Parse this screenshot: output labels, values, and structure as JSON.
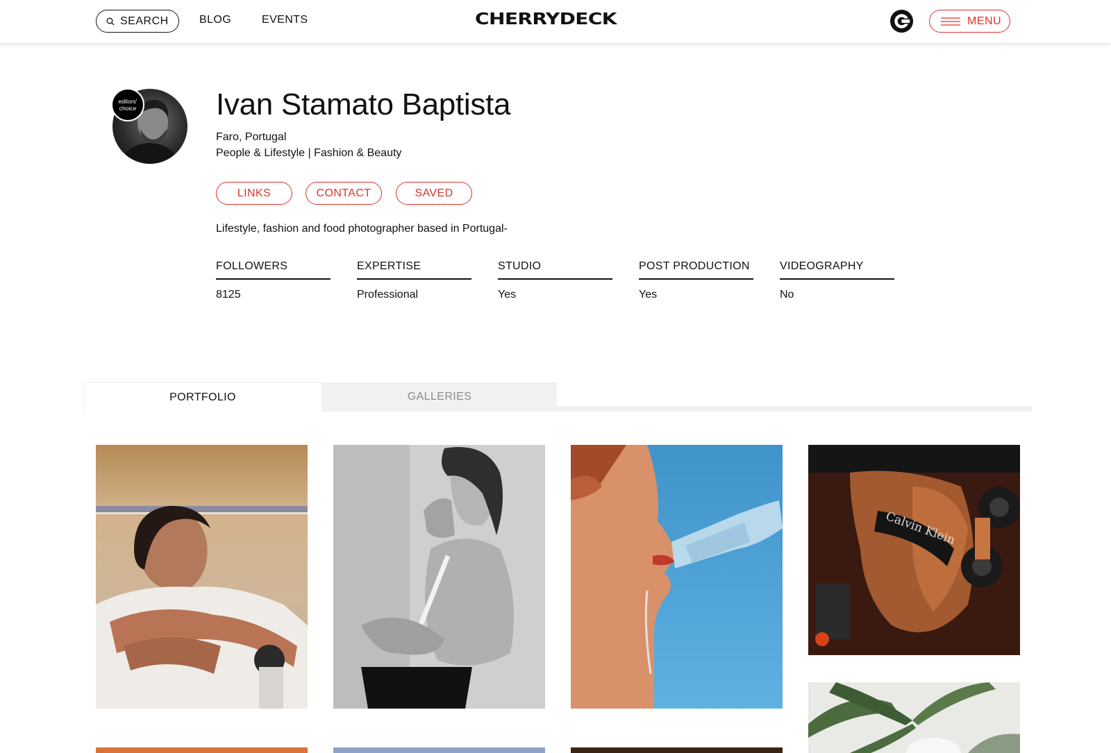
{
  "header": {
    "search_label": "SEARCH",
    "nav": [
      {
        "label": "BLOG"
      },
      {
        "label": "EVENTS"
      }
    ],
    "logo_text": "CHERRYDECK",
    "menu_label": "MENU"
  },
  "profile": {
    "badge_text": "editors' choice",
    "name": "Ivan Stamato Baptista",
    "location": "Faro, Portugal",
    "categories": "People & Lifestyle | Fashion & Beauty",
    "actions": [
      {
        "label": "LINKS"
      },
      {
        "label": "CONTACT"
      },
      {
        "label": "SAVED"
      }
    ],
    "bio": "Lifestyle, fashion and food photographer based in Portugal-",
    "stats": [
      {
        "label": "FOLLOWERS",
        "value": "8125"
      },
      {
        "label": "EXPERTISE",
        "value": "Professional"
      },
      {
        "label": "STUDIO",
        "value": "Yes"
      },
      {
        "label": "POST PRODUCTION",
        "value": "Yes"
      },
      {
        "label": "VIDEOGRAPHY",
        "value": "No"
      }
    ]
  },
  "tabs": [
    {
      "label": "PORTFOLIO",
      "active": true
    },
    {
      "label": "GALLERIES",
      "active": false
    }
  ],
  "photos": [
    {
      "subject": "woman-on-boat-photo"
    },
    {
      "subject": "black-and-white-portrait-photo"
    },
    {
      "subject": "woman-drinking-water-photo"
    },
    {
      "subject": "fitness-dumbbell-photo",
      "overlay_text": "Calvin Klein"
    },
    {
      "subject": "palm-tree-photo"
    }
  ],
  "colors": {
    "accent": "#e0312b",
    "text": "#111111",
    "muted": "#8a8a8a",
    "tab_background": "#f1f1f1"
  }
}
